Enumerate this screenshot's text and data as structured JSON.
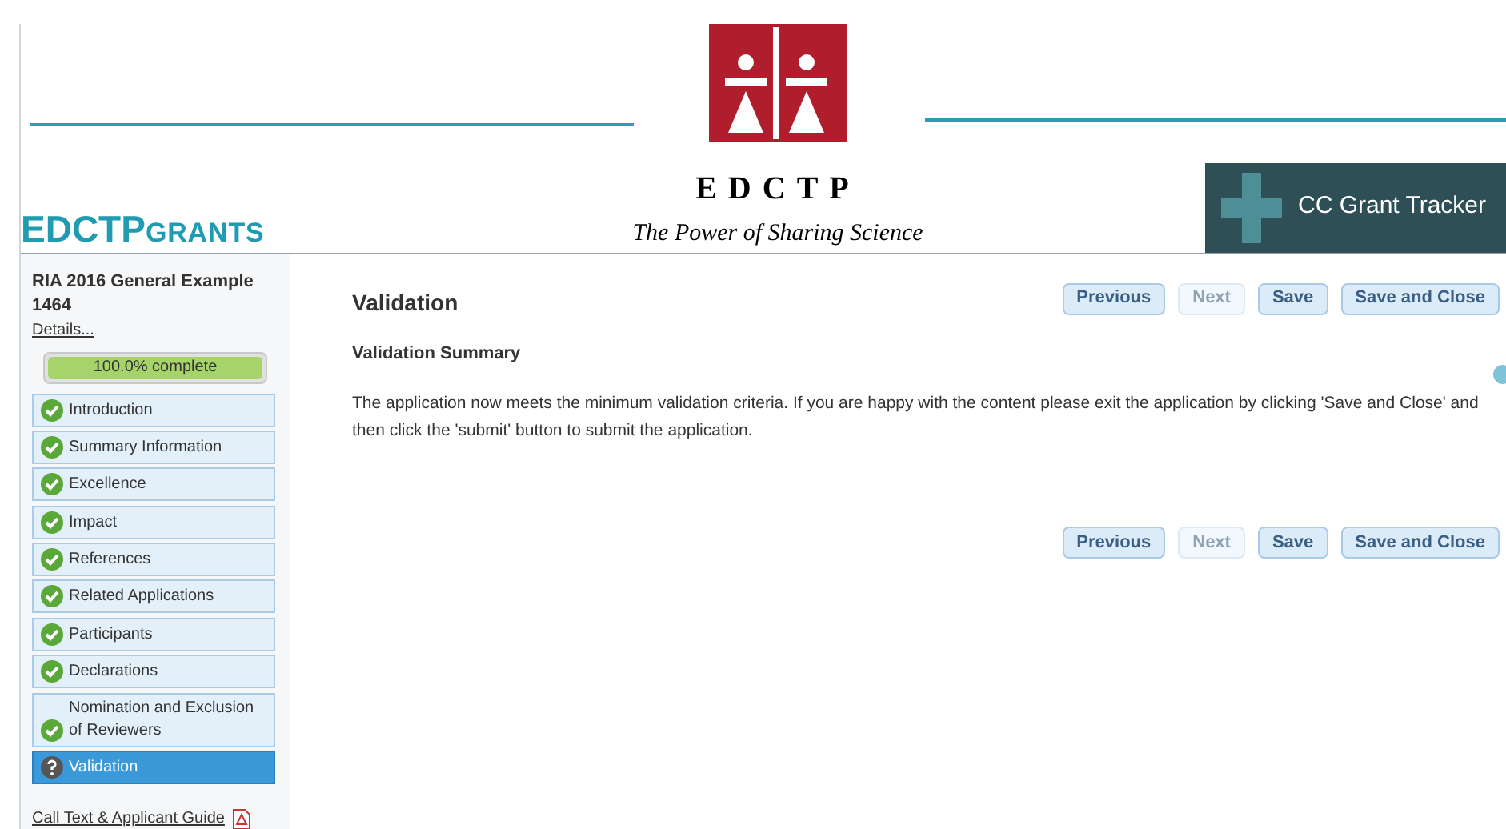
{
  "header": {
    "brand": "EDCTP",
    "brand_accent": "GRANTS",
    "logo_title": "EDCTP",
    "tagline": "The Power of Sharing Science",
    "tracker": "CC Grant Tracker"
  },
  "sidebar": {
    "title": "RIA 2016 General Example 1464",
    "details_link": "Details...",
    "progress": {
      "label": "100.0% complete",
      "level": 1.0
    },
    "items": [
      {
        "label": "Introduction",
        "complete": true,
        "selected": false
      },
      {
        "label": "Summary Information",
        "complete": true,
        "selected": false
      },
      {
        "label": "Excellence",
        "complete": true,
        "selected": false
      },
      {
        "label": "Impact",
        "complete": true,
        "selected": false
      },
      {
        "label": "References",
        "complete": true,
        "selected": false
      },
      {
        "label": "Related Applications",
        "complete": true,
        "selected": false
      },
      {
        "label": "Participants",
        "complete": true,
        "selected": false
      },
      {
        "label": "Declarations",
        "complete": true,
        "selected": false
      },
      {
        "label": "Nomination and Exclusion of Reviewers",
        "complete": true,
        "selected": false
      },
      {
        "label": "Validation",
        "complete": false,
        "selected": true
      }
    ],
    "guide_link": "Call Text & Applicant Guide"
  },
  "main": {
    "title": "Validation",
    "top_buttons": [
      {
        "label": "Previous",
        "disabled": false
      },
      {
        "label": "Next",
        "disabled": true
      },
      {
        "label": "Save",
        "disabled": false
      },
      {
        "label": "Save and Close",
        "disabled": false
      }
    ],
    "section_title": "Validation Summary",
    "message": "The application now meets the minimum validation criteria. If you are happy with the content please exit the application by clicking 'Save and Close' and then click the 'submit' button to submit the application.",
    "bottom_buttons": [
      {
        "label": "Previous",
        "disabled": false
      },
      {
        "label": "Next",
        "disabled": true
      },
      {
        "label": "Save",
        "disabled": false
      },
      {
        "label": "Save and Close",
        "disabled": false
      }
    ]
  }
}
